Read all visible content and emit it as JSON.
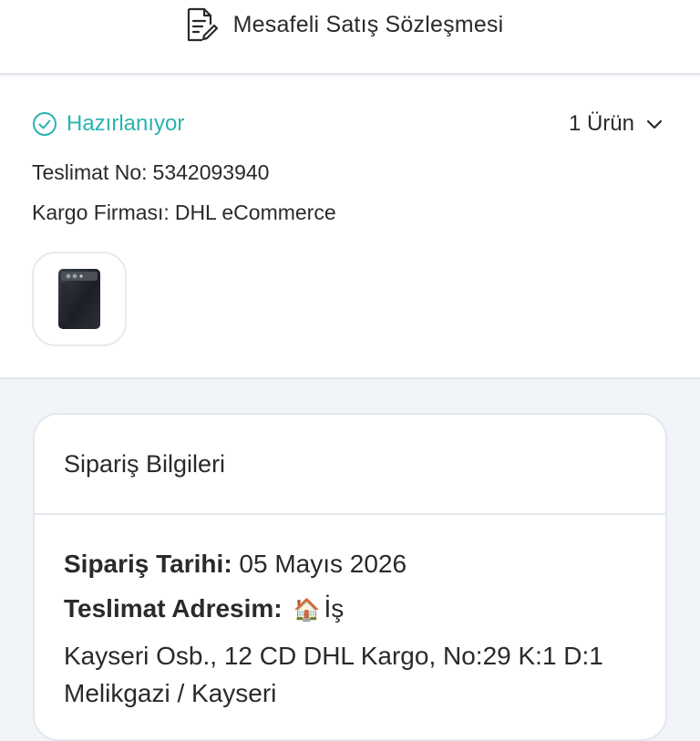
{
  "contract": {
    "title": "Mesafeli Satış Sözleşmesi",
    "icon": "document-edit-icon"
  },
  "order": {
    "status": "Hazırlanıyor",
    "status_icon": "check-circle-icon",
    "status_color": "#2bb3b0",
    "item_count": "1 Ürün",
    "delivery_no_label": "Teslimat No:",
    "delivery_no_value": "5342093940",
    "carrier_label": "Kargo Firması:",
    "carrier_value": "DHL eCommerce",
    "product_image": "phone-product-thumbnail"
  },
  "order_details": {
    "title": "Sipariş Bilgileri",
    "date_label": "Sipariş Tarihi:",
    "date_value": "05 Mayıs 2026",
    "address_label": "Teslimat Adresim:",
    "address_emoji": "🏠",
    "address_name": "İş",
    "address_line1": "Kayseri Osb., 12 CD DHL Kargo, No:29 K:1 D:1",
    "address_line2": "Melikgazi / Kayseri"
  }
}
